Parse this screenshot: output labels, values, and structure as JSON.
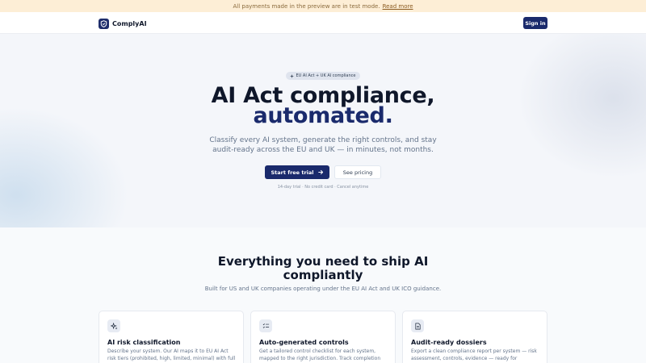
{
  "banner": {
    "text": "All payments made in the preview are in test mode.",
    "link": "Read more"
  },
  "nav": {
    "brand": "ComplyAI",
    "signin": "Sign in"
  },
  "hero": {
    "badge_icon": "sparkle-icon",
    "badge": "EU AI Act + UK AI compliance",
    "title_line1": "AI Act compliance,",
    "title_line2": "automated.",
    "subtitle_line1": "Classify every AI system, generate the right controls, and stay",
    "subtitle_line2": "audit-ready across the EU and UK — in minutes, not months.",
    "cta_primary": "Start free trial",
    "cta_secondary": "See pricing",
    "note": "14-day trial · No credit card · Cancel anytime"
  },
  "features": {
    "heading_line1": "Everything you need to ship AI",
    "heading_line2": "compliantly",
    "subtitle": "Built for US and UK companies operating under the EU AI Act and UK ICO guidance.",
    "cards": [
      {
        "icon": "sparkle-icon",
        "title": "AI risk classification",
        "description": "Describe your system. Our AI maps it to EU AI Act risk tiers (prohibited, high, limited, minimal) with full"
      },
      {
        "icon": "checklist-icon",
        "title": "Auto-generated controls",
        "description": "Get a tailored control checklist for each system, mapped to the right jurisdiction. Track completion"
      },
      {
        "icon": "document-icon",
        "title": "Audit-ready dossiers",
        "description": "Export a clean compliance report per system — risk assessment, controls, evidence — ready for"
      }
    ]
  },
  "colors": {
    "brand": "#1a2a6c",
    "banner_bg": "#fdeed6",
    "hero_bg": "#f4f6fa"
  }
}
